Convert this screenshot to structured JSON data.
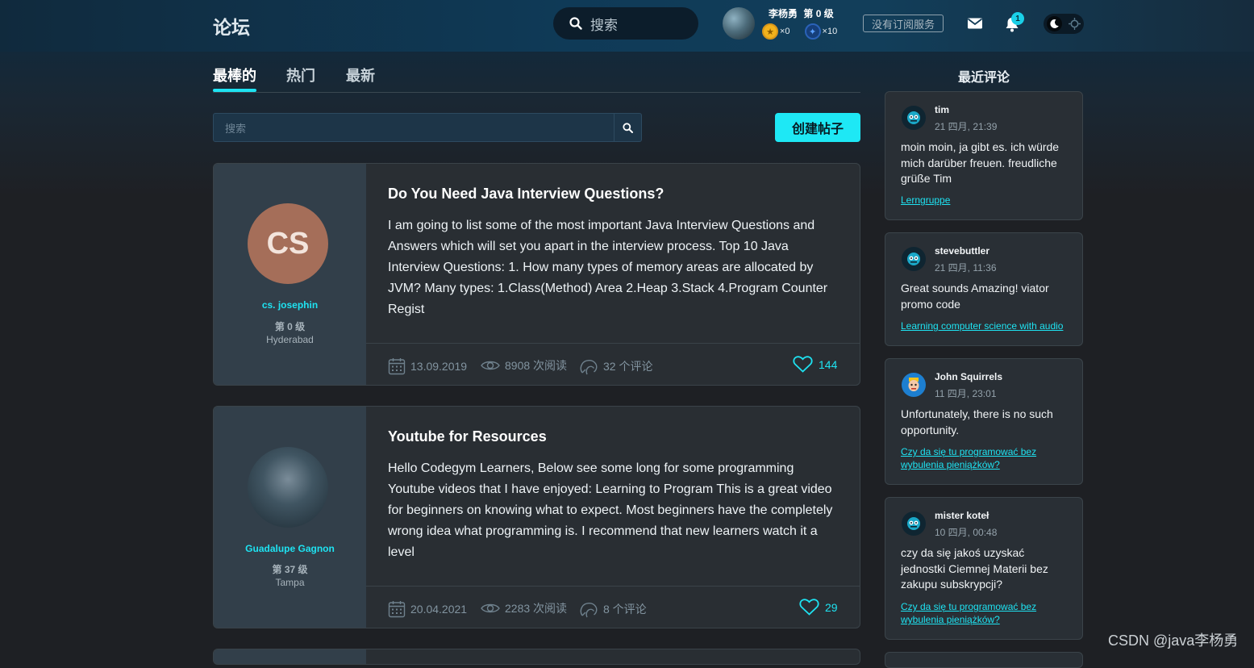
{
  "header": {
    "logo": "论坛",
    "search_label": "搜索",
    "user": {
      "name": "李杨勇",
      "level": "第 0 级",
      "gold_coins": "×0",
      "blue_coins": "×10"
    },
    "subscription_label": "没有订阅服务",
    "notification_count": "1"
  },
  "tabs": [
    "最棒的",
    "热门",
    "最新"
  ],
  "forum_search": {
    "placeholder": "搜索"
  },
  "create_post_label": "创建帖子",
  "posts": [
    {
      "avatar_initials": "CS",
      "author": "cs. josephin",
      "level": "第 0 级",
      "city": "Hyderabad",
      "title": "Do You Need Java Interview Questions?",
      "excerpt": "I am going to list some of the most important Java Interview Questions and Answers which will set you apart in the interview process. Top 10 Java Interview Questions: 1. How many types of memory areas are allocated by JVM? Many types: 1.Class(Method) Area 2.Heap 3.Stack 4.Program Counter Regist",
      "date": "13.09.2019",
      "views": "8908 次阅读",
      "comments": "32 个评论",
      "likes": "144"
    },
    {
      "avatar_initials": "",
      "author": "Guadalupe Gagnon",
      "level": "第 37 级",
      "city": "Tampa",
      "title": "Youtube for Resources",
      "excerpt": "Hello Codegym Learners, Below see some long for some programming Youtube videos that I have enjoyed: Learning to Program This is a great video for beginners on knowing what to expect. Most beginners have the completely wrong idea what programming is. I recommend that new learners watch it a level",
      "date": "20.04.2021",
      "views": "2283 次阅读",
      "comments": "8 个评论",
      "likes": "29"
    }
  ],
  "sidebar": {
    "title": "最近评论",
    "comments": [
      {
        "name": "tim",
        "time": "21 四月, 21:39",
        "text": "moin moin, ja gibt es. ich würde mich darüber freuen. freudliche grüße Tim",
        "link": "Lerngruppe"
      },
      {
        "name": "stevebuttler",
        "time": "21 四月, 11:36",
        "text": "Great sounds Amazing! viator promo code",
        "link": "Learning computer science with audio"
      },
      {
        "name": "John Squirrels",
        "time": "11 四月, 23:01",
        "text": "Unfortunately, there is no such opportunity.",
        "link": "Czy da się tu programować bez wybulenia pieniążków?"
      },
      {
        "name": "mister koteł",
        "time": "10 四月, 00:48",
        "text": "czy da się jakoś uzyskać jednostki Ciemnej Materii bez zakupu subskrypcji?",
        "link": "Czy da się tu programować bez wybulenia pieniążków?"
      }
    ]
  },
  "watermark": "CSDN @java李杨勇",
  "colors": {
    "accent": "#1ee3f2",
    "card": "#292e33",
    "author_panel": "#323f4a",
    "page_bg": "#1e2024"
  }
}
